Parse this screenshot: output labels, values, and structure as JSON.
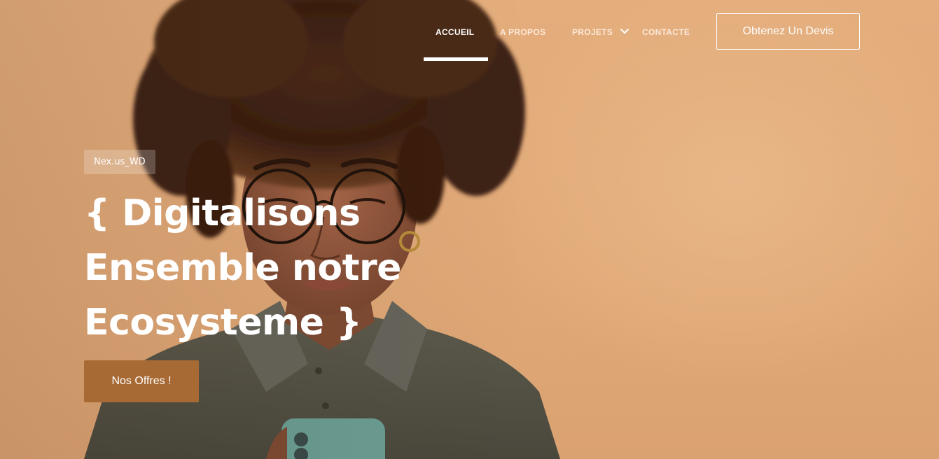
{
  "nav": {
    "items": [
      {
        "label": "ACCUEIL",
        "active": true
      },
      {
        "label": "A PROPOS",
        "active": false
      },
      {
        "label": "PROJETS",
        "active": false,
        "has_dropdown": true
      },
      {
        "label": "CONTACTE",
        "active": false
      }
    ],
    "quote_button": "Obtenez Un Devis"
  },
  "hero": {
    "badge": "Nex.us_WD",
    "headline_lines": [
      "{ Digitalisons",
      "Ensemble notre",
      "Ecosysteme }"
    ],
    "cta": "Nos Offres !"
  },
  "colors": {
    "background": "#e3ad7c",
    "cta": "#a86a34",
    "text": "#ffffff"
  },
  "icons": {
    "dropdown": "chevron-down-icon"
  }
}
